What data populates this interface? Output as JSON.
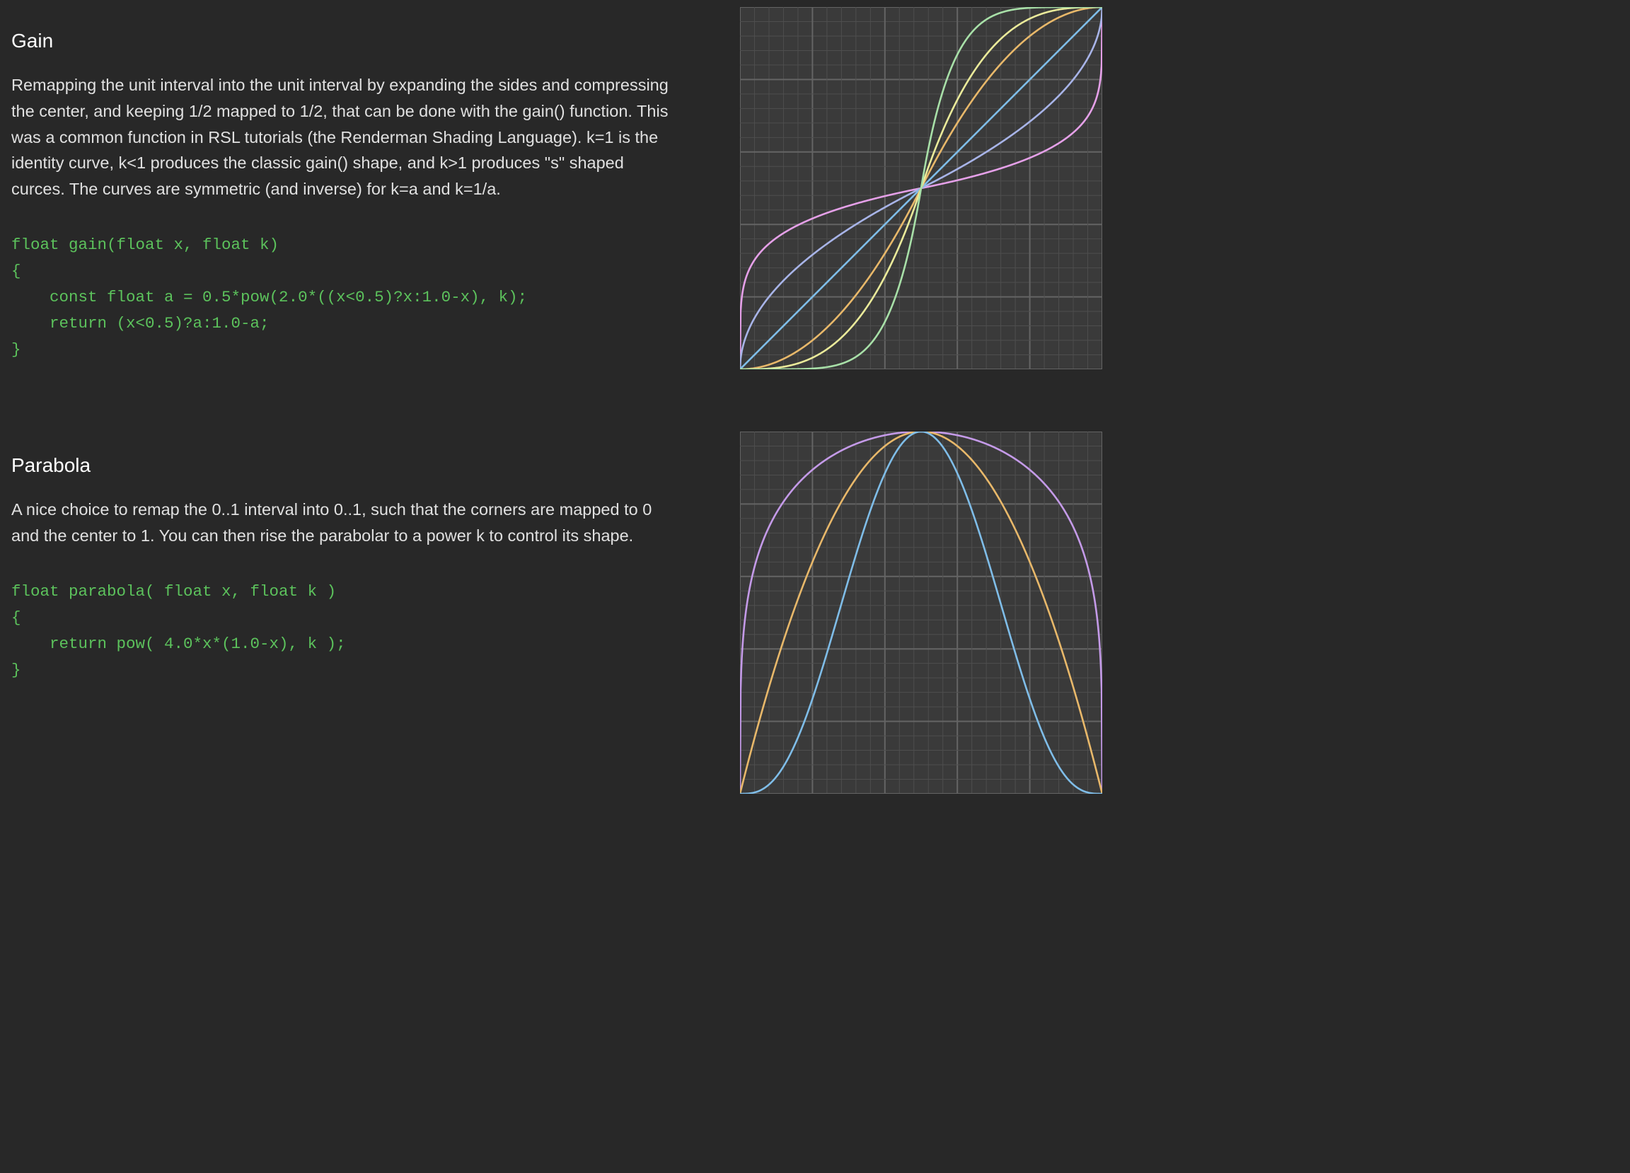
{
  "gain": {
    "title": "Gain",
    "description": "Remapping the unit interval into the unit interval by expanding the sides and compressing the center, and keeping 1/2 mapped to 1/2, that can be done with the gain() function. This was a common function in RSL tutorials (the Renderman Shading Language). k=1 is the identity curve, k<1 produces the classic gain() shape, and k>1 produces \"s\" shaped curces. The curves are symmetric (and inverse) for k=a and k=1/a.",
    "code": [
      "float gain(float x, float k)",
      "{",
      "    const float a = 0.5*pow(2.0*((x<0.5)?x:1.0-x), k);",
      "    return (x<0.5)?a:1.0-a;",
      "}"
    ]
  },
  "parabola": {
    "title": "Parabola",
    "description": "A nice choice to remap the 0..1 interval into 0..1, such that the corners are mapped to 0 and the center to 1. You can then rise the parabolar to a power k to control its shape.",
    "code": [
      "float parabola( float x, float k )",
      "{",
      "    return pow( 4.0*x*(1.0-x), k );",
      "}"
    ]
  },
  "colors": {
    "background": "#282828",
    "text": "#e0e0e0",
    "code": "#5cc25c",
    "plot_background": "#3a3a3a",
    "grid_minor": "#4e4e4e",
    "grid_major": "#646464"
  },
  "chart_data": [
    {
      "type": "line",
      "function": "gain",
      "title": "",
      "xlabel": "",
      "ylabel": "",
      "xlim": [
        0,
        1
      ],
      "ylim": [
        0,
        1
      ],
      "grid": true,
      "series": [
        {
          "k": 0.2,
          "color": "#e5a0e8"
        },
        {
          "k": 0.5,
          "color": "#a8b4e8"
        },
        {
          "k": 1.0,
          "color": "#7fbde8"
        },
        {
          "k": 2.0,
          "color": "#e8b86a"
        },
        {
          "k": 3.0,
          "color": "#eaea9a"
        },
        {
          "k": 6.0,
          "color": "#a8e0a8"
        }
      ]
    },
    {
      "type": "line",
      "function": "parabola",
      "title": "",
      "xlabel": "",
      "ylabel": "",
      "xlim": [
        0,
        1
      ],
      "ylim": [
        0,
        1
      ],
      "grid": true,
      "series": [
        {
          "k": 0.25,
          "color": "#c49ae8"
        },
        {
          "k": 1.0,
          "color": "#e8b86a"
        },
        {
          "k": 3.0,
          "color": "#7fbde8"
        }
      ]
    }
  ]
}
